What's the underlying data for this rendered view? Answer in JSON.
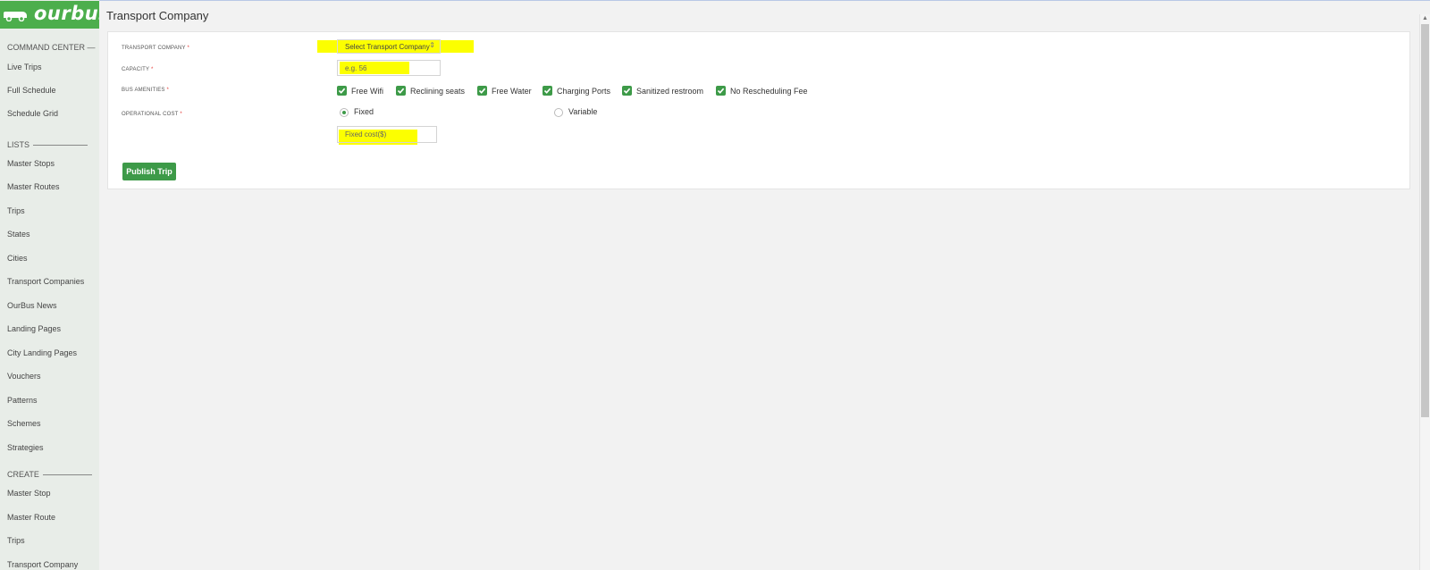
{
  "brand": {
    "name": "ourbus",
    "color": "#4cae4c"
  },
  "sidebar": {
    "command_center": "COMMAND CENTER —",
    "command_items": [
      "Live Trips",
      "Full Schedule",
      "Schedule Grid"
    ],
    "lists_label": "LISTS",
    "list_items": [
      "Master Stops",
      "Master Routes",
      "Trips",
      "States",
      "Cities",
      "Transport Companies",
      "OurBus News",
      "Landing Pages",
      "City Landing Pages",
      "Vouchers",
      "Patterns",
      "Schemes",
      "Strategies"
    ],
    "create_label": "CREATE",
    "create_items": [
      "Master Stop",
      "Master Route",
      "Trips",
      "Transport Company"
    ]
  },
  "page": {
    "title": "Transport Company"
  },
  "form": {
    "transport_company": {
      "label": "TRANSPORT COMPANY",
      "required": "*",
      "select_value": "Select Transport Company"
    },
    "capacity": {
      "label": "CAPACITY",
      "required": "*",
      "placeholder": "e.g. 56"
    },
    "amenities": {
      "label": "BUS AMENITIES",
      "required": "*",
      "items": [
        "Free Wifi",
        "Reclining seats",
        "Free Water",
        "Charging Ports",
        "Sanitized restroom",
        "No Rescheduling Fee"
      ]
    },
    "operational_cost": {
      "label": "OPERATIONAL COST",
      "required": "*",
      "fixed_label": "Fixed",
      "variable_label": "Variable",
      "selected": "Fixed",
      "fixed_cost_placeholder": "Fixed cost($)"
    },
    "publish_label": "Publish Trip"
  },
  "colors": {
    "accent": "#3d9a48",
    "highlight": "#fcff00",
    "required": "#e53935"
  }
}
